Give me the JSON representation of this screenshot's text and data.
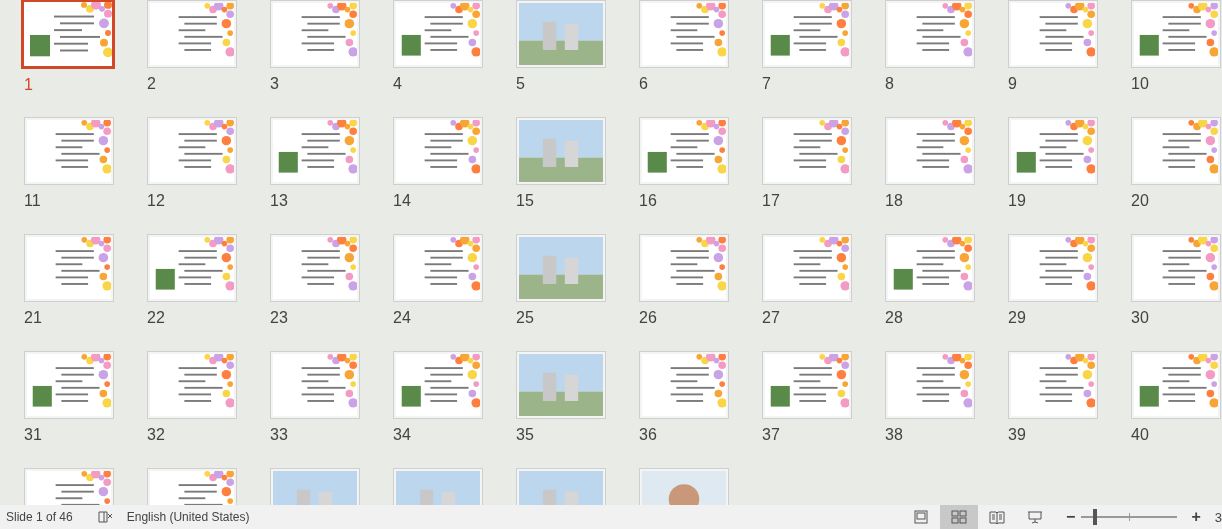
{
  "slides": [
    {
      "number": "1",
      "selected": true
    },
    {
      "number": "2",
      "selected": false
    },
    {
      "number": "3",
      "selected": false
    },
    {
      "number": "4",
      "selected": false
    },
    {
      "number": "5",
      "selected": false
    },
    {
      "number": "6",
      "selected": false
    },
    {
      "number": "7",
      "selected": false
    },
    {
      "number": "8",
      "selected": false
    },
    {
      "number": "9",
      "selected": false
    },
    {
      "number": "10",
      "selected": false
    },
    {
      "number": "11",
      "selected": false
    },
    {
      "number": "12",
      "selected": false
    },
    {
      "number": "13",
      "selected": false
    },
    {
      "number": "14",
      "selected": false
    },
    {
      "number": "15",
      "selected": false
    },
    {
      "number": "16",
      "selected": false
    },
    {
      "number": "17",
      "selected": false
    },
    {
      "number": "18",
      "selected": false
    },
    {
      "number": "19",
      "selected": false
    },
    {
      "number": "20",
      "selected": false
    },
    {
      "number": "21",
      "selected": false
    },
    {
      "number": "22",
      "selected": false
    },
    {
      "number": "23",
      "selected": false
    },
    {
      "number": "24",
      "selected": false
    },
    {
      "number": "25",
      "selected": false
    },
    {
      "number": "26",
      "selected": false
    },
    {
      "number": "27",
      "selected": false
    },
    {
      "number": "28",
      "selected": false
    },
    {
      "number": "29",
      "selected": false
    },
    {
      "number": "30",
      "selected": false
    },
    {
      "number": "31",
      "selected": false
    },
    {
      "number": "32",
      "selected": false
    },
    {
      "number": "33",
      "selected": false
    },
    {
      "number": "34",
      "selected": false
    },
    {
      "number": "35",
      "selected": false
    },
    {
      "number": "36",
      "selected": false
    },
    {
      "number": "37",
      "selected": false
    },
    {
      "number": "38",
      "selected": false
    },
    {
      "number": "39",
      "selected": false
    },
    {
      "number": "40",
      "selected": false
    },
    {
      "selected": false
    },
    {
      "selected": false
    },
    {
      "selected": false
    },
    {
      "selected": false
    },
    {
      "selected": false
    },
    {
      "selected": false
    }
  ],
  "status_bar": {
    "slide_info": "Slide 1 of 46",
    "language": "English (United States)",
    "views": [
      {
        "kind": "normal",
        "selected": false
      },
      {
        "kind": "sorter",
        "selected": true
      },
      {
        "kind": "reading",
        "selected": false
      },
      {
        "kind": "slideshow",
        "selected": false
      }
    ],
    "zoom_out": "−",
    "zoom_in": "+",
    "zoom": {
      "level": 0.12
    },
    "zoom_percent": "3"
  }
}
